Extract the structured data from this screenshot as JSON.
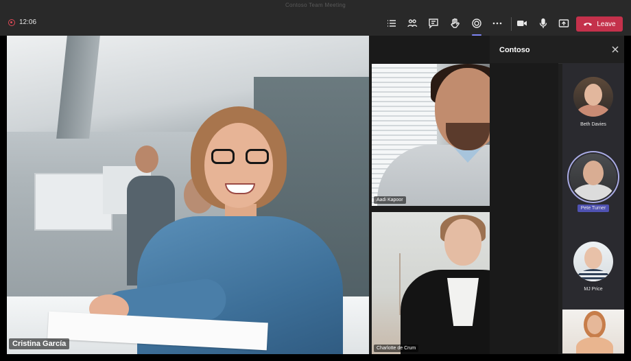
{
  "window": {
    "title": "Contoso Team Meeting"
  },
  "toolbar": {
    "timer": "12:06",
    "buttons": [
      {
        "name": "participants-list",
        "icon": "list-icon"
      },
      {
        "name": "people",
        "icon": "people-icon"
      },
      {
        "name": "chat",
        "icon": "chat-icon"
      },
      {
        "name": "raise-hand",
        "icon": "hand-icon"
      },
      {
        "name": "together-mode",
        "icon": "together-mode-icon",
        "active": true
      },
      {
        "name": "more-actions",
        "icon": "more-icon"
      },
      {
        "name": "camera",
        "icon": "camera-icon"
      },
      {
        "name": "microphone",
        "icon": "mic-icon"
      },
      {
        "name": "share",
        "icon": "share-icon"
      }
    ],
    "leave_label": "Leave",
    "leave_color": "#c4314b",
    "accent_color": "#7f85f5"
  },
  "stage": {
    "main_participant": "Cristina García",
    "tiles": [
      {
        "name": "Aadi Kapoor"
      },
      {
        "name": "Charlotte de Crum"
      }
    ]
  },
  "panel": {
    "title": "Contoso",
    "participants": [
      {
        "name": "Beth Davies",
        "highlighted": false
      },
      {
        "name": "Pete Turner",
        "highlighted": true
      },
      {
        "name": "MJ Price",
        "highlighted": false
      }
    ],
    "highlight_color": "#4f52b2"
  }
}
